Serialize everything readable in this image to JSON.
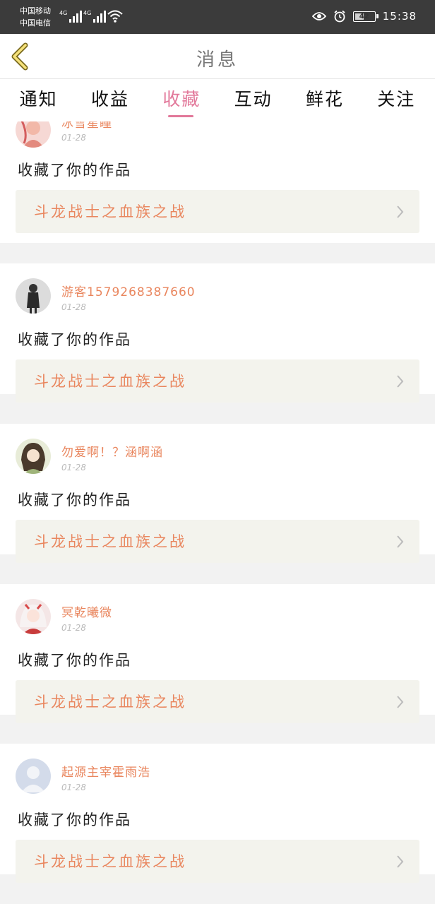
{
  "status_bar": {
    "carrier_1": "中国移动",
    "carrier_2": "中国电信",
    "network_1": "4G",
    "network_2": "4G",
    "battery": "42",
    "time": "15:38",
    "icons": [
      "signal-icon",
      "wifi-icon",
      "eye-icon",
      "alarm-icon",
      "battery-icon"
    ]
  },
  "header": {
    "title": "消息",
    "back_icon": "chevron-left-icon"
  },
  "tabs": [
    {
      "label": "通知",
      "active": false
    },
    {
      "label": "收益",
      "active": false
    },
    {
      "label": "收藏",
      "active": true
    },
    {
      "label": "互动",
      "active": false
    },
    {
      "label": "鲜花",
      "active": false
    },
    {
      "label": "关注",
      "active": false
    }
  ],
  "notifications": [
    {
      "user": "冰雪星瞳",
      "date": "01-28",
      "action": "收藏了你的作品",
      "work_title": "斗龙战士之血族之战"
    },
    {
      "user": "游客1579268387660",
      "date": "01-28",
      "action": "收藏了你的作品",
      "work_title": "斗龙战士之血族之战"
    },
    {
      "user": "勿爱啊！？涵啊涵",
      "date": "01-28",
      "action": "收藏了你的作品",
      "work_title": "斗龙战士之血族之战"
    },
    {
      "user": "冥乾曦微",
      "date": "01-28",
      "action": "收藏了你的作品",
      "work_title": "斗龙战士之血族之战"
    },
    {
      "user": "起源主宰霍雨浩",
      "date": "01-28",
      "action": "收藏了你的作品",
      "work_title": "斗龙战士之血族之战"
    }
  ],
  "colors": {
    "accent": "#e2789a",
    "username": "#e9865e",
    "status_bar_bg": "#3b3b3b",
    "work_bg": "#f3f3ed"
  }
}
